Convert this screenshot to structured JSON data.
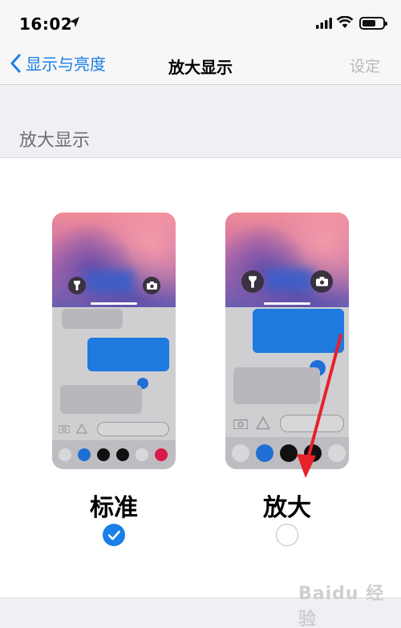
{
  "status_bar": {
    "time": "16:02"
  },
  "nav": {
    "back_label": "显示与亮度",
    "title": "放大显示",
    "right_label": "设定"
  },
  "section": {
    "header": "放大显示"
  },
  "options": [
    {
      "label": "标准",
      "selected": true
    },
    {
      "label": "放大",
      "selected": false
    }
  ],
  "watermark": "Baidu 经验",
  "colors": {
    "accent": "#1a7fe6",
    "annotation_arrow": "#e8202a"
  }
}
